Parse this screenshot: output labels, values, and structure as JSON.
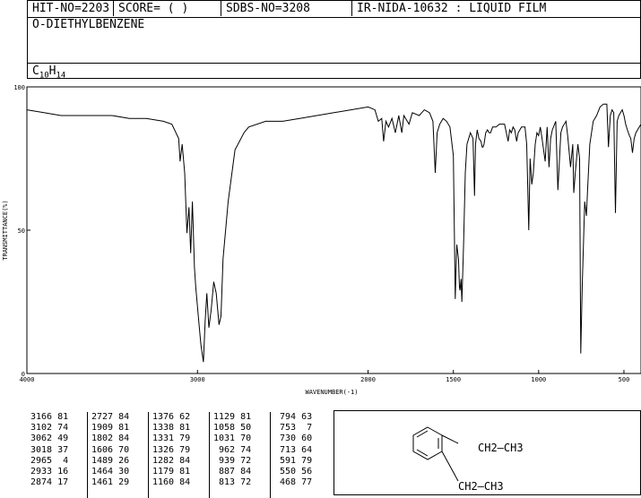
{
  "header": {
    "hit_no": "HIT-NO=2203",
    "score": "SCORE=  (   )",
    "sdbs_no": "SDBS-NO=3208",
    "ir_info": "IR-NIDA-10632 : LIQUID FILM",
    "compound_name": "O-DIETHYLBENZENE",
    "formula_c": "C",
    "formula_c_sub": "10",
    "formula_h": "H",
    "formula_h_sub": "14"
  },
  "chart_data": {
    "type": "line",
    "xlabel": "WAVENUMBER(-1)",
    "ylabel": "TRANSMITTANCE(%)",
    "xlim": [
      4000,
      400
    ],
    "ylim": [
      0,
      100
    ],
    "xticks": [
      4000,
      3000,
      2000,
      1500,
      1000,
      500
    ],
    "yticks": [
      0,
      50,
      100
    ],
    "grid": false,
    "x": [
      4000,
      3900,
      3800,
      3700,
      3600,
      3500,
      3400,
      3300,
      3200,
      3150,
      3110,
      3102,
      3090,
      3075,
      3062,
      3050,
      3040,
      3030,
      3018,
      3010,
      2995,
      2980,
      2965,
      2955,
      2945,
      2933,
      2920,
      2905,
      2890,
      2874,
      2862,
      2850,
      2820,
      2780,
      2727,
      2700,
      2600,
      2500,
      2400,
      2300,
      2200,
      2100,
      2000,
      1960,
      1940,
      1920,
      1909,
      1895,
      1880,
      1860,
      1840,
      1820,
      1802,
      1790,
      1760,
      1740,
      1700,
      1670,
      1640,
      1620,
      1606,
      1595,
      1580,
      1560,
      1540,
      1520,
      1500,
      1489,
      1480,
      1470,
      1464,
      1461,
      1455,
      1450,
      1440,
      1430,
      1420,
      1400,
      1385,
      1376,
      1370,
      1360,
      1350,
      1338,
      1331,
      1326,
      1320,
      1310,
      1300,
      1290,
      1282,
      1270,
      1250,
      1230,
      1200,
      1179,
      1170,
      1160,
      1150,
      1140,
      1129,
      1120,
      1100,
      1080,
      1070,
      1058,
      1050,
      1040,
      1031,
      1020,
      1010,
      1000,
      990,
      980,
      962,
      950,
      939,
      930,
      920,
      900,
      887,
      870,
      860,
      840,
      830,
      813,
      800,
      794,
      785,
      770,
      760,
      753,
      745,
      730,
      720,
      713,
      700,
      680,
      660,
      640,
      620,
      600,
      591,
      580,
      570,
      560,
      550,
      540,
      530,
      520,
      510,
      500,
      490,
      480,
      468,
      460,
      450,
      440,
      430,
      420,
      410,
      400
    ],
    "y": [
      92,
      91,
      90,
      90,
      90,
      90,
      89,
      89,
      88,
      87,
      82,
      74,
      80,
      70,
      49,
      58,
      42,
      60,
      37,
      30,
      20,
      10,
      4,
      18,
      28,
      16,
      22,
      32,
      28,
      17,
      20,
      40,
      60,
      78,
      84,
      86,
      88,
      88,
      89,
      90,
      91,
      92,
      93,
      92,
      88,
      89,
      81,
      88,
      86,
      89,
      84,
      90,
      84,
      90,
      87,
      91,
      90,
      92,
      91,
      88,
      70,
      84,
      87,
      89,
      88,
      86,
      76,
      26,
      45,
      40,
      30,
      29,
      33,
      25,
      45,
      70,
      80,
      84,
      82,
      62,
      80,
      85,
      82,
      81,
      79,
      79,
      80,
      84,
      85,
      84,
      84,
      86,
      86,
      87,
      87,
      81,
      85,
      84,
      86,
      85,
      81,
      84,
      86,
      86,
      80,
      50,
      75,
      66,
      70,
      80,
      84,
      83,
      86,
      82,
      74,
      86,
      72,
      82,
      85,
      88,
      64,
      84,
      86,
      88,
      83,
      72,
      80,
      63,
      70,
      80,
      75,
      7,
      30,
      60,
      55,
      64,
      80,
      88,
      90,
      93,
      94,
      94,
      79,
      90,
      92,
      91,
      56,
      88,
      90,
      91,
      92,
      90,
      87,
      85,
      83,
      82,
      77,
      82,
      84,
      85,
      86,
      87,
      87
    ]
  },
  "peak_table": {
    "columns": [
      [
        "3166 81",
        "3102 74",
        "3062 49",
        "3018 37",
        "2965  4",
        "2933 16",
        "2874 17"
      ],
      [
        "2727 84",
        "1909 81",
        "1802 84",
        "1606 70",
        "1489 26",
        "1464 30",
        "1461 29"
      ],
      [
        "1376 62",
        "1338 81",
        "1331 79",
        "1326 79",
        "1282 84",
        "1179 81",
        "1160 84"
      ],
      [
        "1129 81",
        "1058 50",
        "1031 70",
        " 962 74",
        " 939 72",
        " 887 84",
        " 813 72"
      ],
      [
        " 794 63",
        " 753  7",
        " 730 60",
        " 713 64",
        " 591 79",
        " 550 56",
        " 468 77"
      ]
    ]
  },
  "structure": {
    "top_group": "CH2—CH3",
    "bottom_group": "CH2—CH3"
  }
}
